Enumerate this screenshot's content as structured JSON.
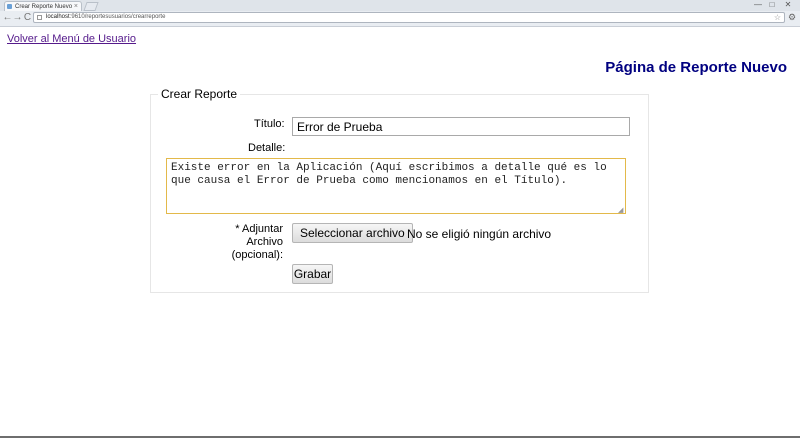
{
  "browser": {
    "tab_title": "Crear Reporte Nuevo",
    "tab_close": "×",
    "window_min": "—",
    "window_max": "□",
    "window_close": "✕",
    "back_arrow": "←",
    "forward_arrow": "→",
    "reload": "C",
    "url_host": "localhost",
    "url_rest": ":9610/reportesusuarios/crearreporte",
    "star": "☆",
    "wrench": "⚙"
  },
  "page": {
    "back_link": "Volver al Menú de Usuario",
    "title": "Página de Reporte Nuevo"
  },
  "form": {
    "legend": "Crear Reporte",
    "title_label": "Título:",
    "title_value": "Error de Prueba",
    "detail_label": "Detalle:",
    "detail_value": "Existe error en la Aplicación (Aquí escribimos a detalle qué es lo que causa el Error de Prueba como mencionamos en el Título).",
    "attach_label_line1": "* Adjuntar Archivo",
    "attach_label_line2": "(opcional):",
    "file_button": "Seleccionar archivo",
    "file_status": "No se eligió ningún archivo",
    "submit": "Grabar"
  }
}
